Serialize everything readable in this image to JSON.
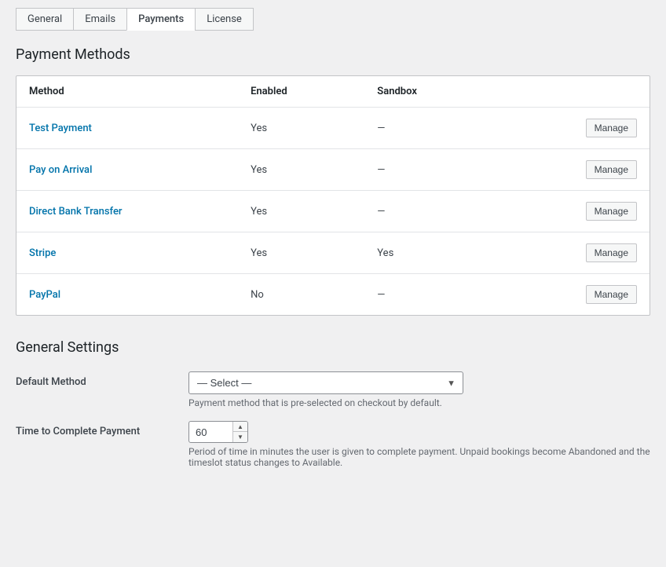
{
  "tabs": [
    {
      "id": "general",
      "label": "General",
      "active": false
    },
    {
      "id": "emails",
      "label": "Emails",
      "active": false
    },
    {
      "id": "payments",
      "label": "Payments",
      "active": true
    },
    {
      "id": "license",
      "label": "License",
      "active": false
    }
  ],
  "payment_methods": {
    "section_title": "Payment Methods",
    "table_headers": {
      "method": "Method",
      "enabled": "Enabled",
      "sandbox": "Sandbox"
    },
    "rows": [
      {
        "id": "test-payment",
        "name": "Test Payment",
        "enabled": "Yes",
        "sandbox": "—"
      },
      {
        "id": "pay-on-arrival",
        "name": "Pay on Arrival",
        "enabled": "Yes",
        "sandbox": "—"
      },
      {
        "id": "direct-bank-transfer",
        "name": "Direct Bank Transfer",
        "enabled": "Yes",
        "sandbox": "—"
      },
      {
        "id": "stripe",
        "name": "Stripe",
        "enabled": "Yes",
        "sandbox": "Yes"
      },
      {
        "id": "paypal",
        "name": "PayPal",
        "enabled": "No",
        "sandbox": "—"
      }
    ],
    "manage_label": "Manage"
  },
  "general_settings": {
    "section_title": "General Settings",
    "default_method": {
      "label": "Default Method",
      "select_placeholder": "— Select —",
      "description": "Payment method that is pre-selected on checkout by default."
    },
    "time_to_complete": {
      "label": "Time to Complete Payment",
      "value": "60",
      "description": "Period of time in minutes the user is given to complete payment. Unpaid bookings become Abandoned and the timeslot status changes to Available."
    }
  }
}
